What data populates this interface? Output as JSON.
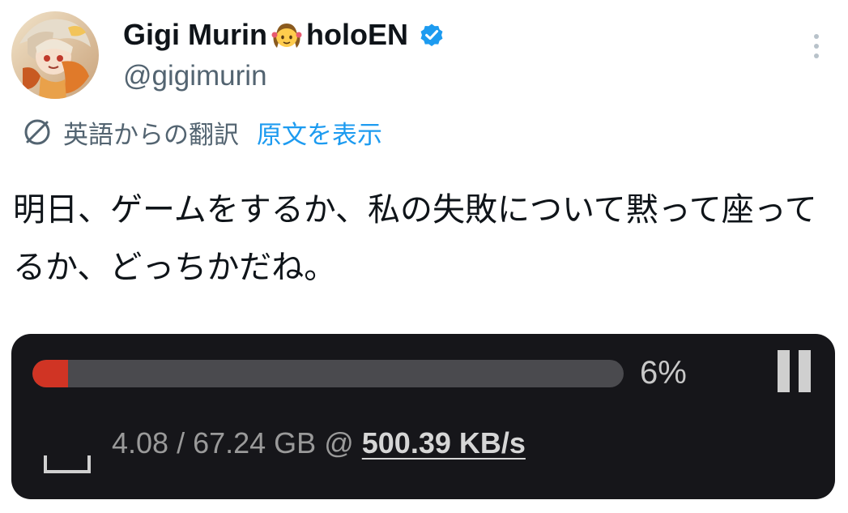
{
  "tweet": {
    "display_name": "Gigi Murin",
    "display_name_suffix": "holoEN",
    "name_emoji_icon": "girl-emoji-icon",
    "verified_icon": "verified-badge-icon",
    "handle": "@gigimurin",
    "translation": {
      "label": "英語からの翻訳",
      "show_original": "原文を表示"
    },
    "text": "明日、ゲームをするか、私の失敗について黙って座ってるか、どっちかだね。",
    "colors": {
      "text": "#0f1419",
      "secondary": "#536471",
      "link": "#1d9bf0",
      "verified": "#1d9bf0"
    }
  },
  "download_widget": {
    "percent_text": "6%",
    "progress": 0.06,
    "downloaded": "4.08",
    "separator": " / ",
    "total": "67.24 GB",
    "at": " @",
    "speed": "500.39 KB/s",
    "pause_icon": "pause-icon",
    "folder_icon": "folder-icon",
    "colors": {
      "background": "#16161a",
      "track": "#4a4a4e",
      "fill": "#d03424",
      "text": "#9a9a9a"
    }
  }
}
